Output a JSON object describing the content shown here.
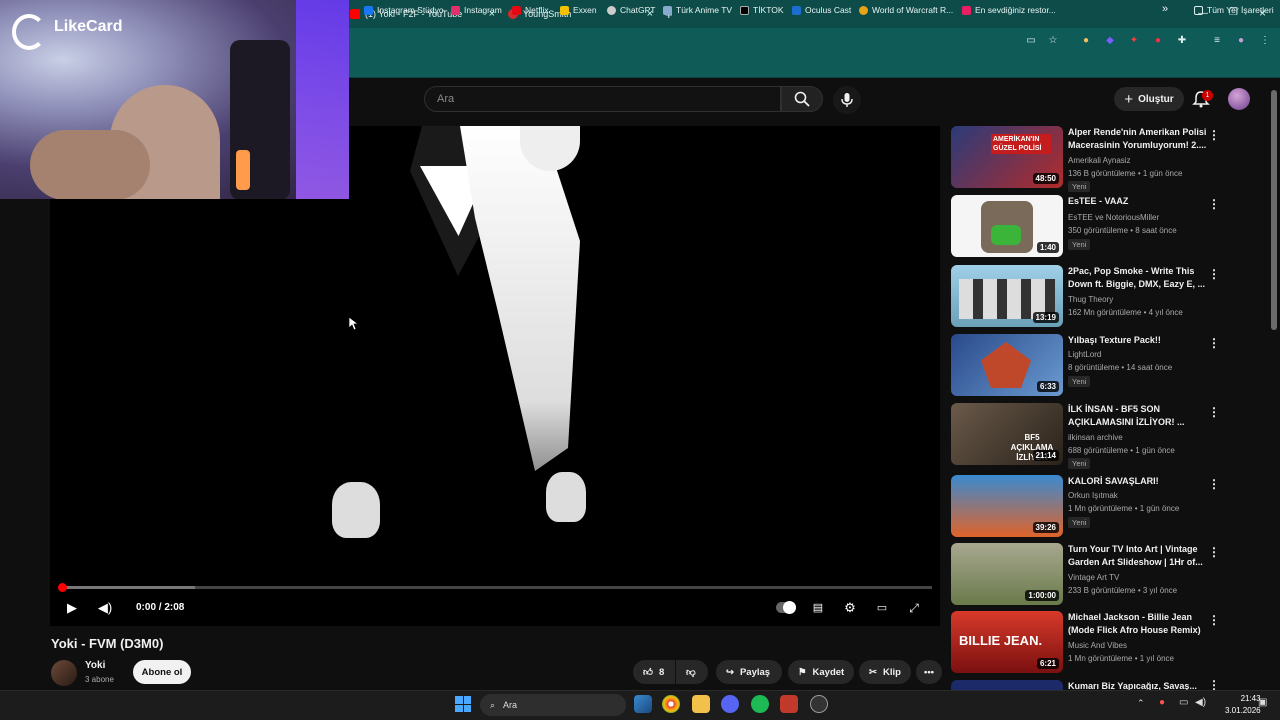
{
  "browser": {
    "tabs": [
      {
        "label": "(1) Yoki - F2F - YouTube",
        "color": "#ff0000"
      },
      {
        "label": "YoungSmith",
        "color": "#d62b2b"
      }
    ],
    "new_tab_label": "+",
    "bookmarks": [
      {
        "label": "Instagram Stüdyo",
        "color": "#1877f2"
      },
      {
        "label": "Instagram",
        "color": "#e1306c"
      },
      {
        "label": "Netflix",
        "color": "#e50914"
      },
      {
        "label": "Exxen",
        "color": "#f2c200"
      },
      {
        "label": "ChatGPT",
        "color": "#cccccc"
      },
      {
        "label": "Türk Anime TV",
        "color": "#88aacc"
      },
      {
        "label": "TİKTOK",
        "color": "#000000"
      },
      {
        "label": "Oculus Cast",
        "color": "#1c6fd1"
      },
      {
        "label": "World of Warcraft R...",
        "color": "#e8a317"
      },
      {
        "label": "En sevdiğiniz restor...",
        "color": "#e91e63"
      }
    ],
    "bookmarks_more": "»",
    "all_bookmarks": "Tüm Yer İşaretleri"
  },
  "webcam": {
    "brand": "LikeCard"
  },
  "youtube": {
    "search_placeholder": "Ara",
    "create_label": "Oluştur",
    "notification_count": "1"
  },
  "player": {
    "time": "0:00 / 2:08",
    "progress_fraction": 0,
    "buffered_fraction": 0.153
  },
  "video": {
    "title": "Yoki - FVM (D3M0)",
    "channel": "Yoki",
    "subscribers": "3 abone",
    "subscribe_label": "Abone ol",
    "likes": "8",
    "share_label": "Paylaş",
    "save_label": "Kaydet",
    "clip_label": "Klip",
    "more_label": "•••"
  },
  "recommendations": [
    {
      "title": "Alper Rende'nin Amerikan Polisi Macerasinin Yorumluyorum! 2....",
      "channel": "Amerikali Aynasiz",
      "meta": "136 B görüntüleme • 1 gün önce",
      "new": "Yeni",
      "duration": "48:50",
      "thumb": "#b22b2b"
    },
    {
      "title": "EsTEE - VAAZ",
      "channel": "EsTEE ve NotoriousMiller",
      "meta": "350 görüntüleme • 8 saat önce",
      "new": "Yeni",
      "duration": "1:40",
      "thumb": "#f5f5f5"
    },
    {
      "title": "2Pac, Pop Smoke - Write This Down ft. Biggie, DMX, Eazy E, ...",
      "channel": "Thug Theory",
      "meta": "162 Mn görüntüleme • 4 yıl önce",
      "new": "",
      "duration": "13:19",
      "thumb": "#8fbfd8"
    },
    {
      "title": "Yılbaşı Texture Pack!!",
      "channel": "LightLord",
      "meta": "8 görüntüleme • 14 saat önce",
      "new": "Yeni",
      "duration": "6:33",
      "thumb": "#3a5fa0"
    },
    {
      "title": "İLK İNSAN - BF5 SON AÇIKLAMASINI İZLİYOR! ...",
      "channel": "ilkinsan archive",
      "meta": "688 görüntüleme • 1 gün önce",
      "new": "Yeni",
      "duration": "21:14",
      "thumb": "#5a4a3c"
    },
    {
      "title": "KALORİ SAVAŞLARI!",
      "channel": "Orkun Işıtmak",
      "meta": "1 Mn görüntüleme • 1 gün önce",
      "new": "Yeni",
      "duration": "39:26",
      "thumb": "#3a8ad0"
    },
    {
      "title": "Turn Your TV Into Art | Vintage Garden Art Slideshow | 1Hr of...",
      "channel": "Vintage Art TV",
      "meta": "233 B görüntüleme • 3 yıl önce",
      "new": "",
      "duration": "1:00:00",
      "thumb": "#8a8a6a"
    },
    {
      "title": "Michael Jackson - Billie Jean (Mode Flick Afro House Remix)",
      "channel": "Music And Vibes",
      "meta": "1 Mn görüntüleme • 1 yıl önce",
      "new": "",
      "duration": "6:21",
      "thumb": "#b8242a"
    },
    {
      "title": "Kumarı Biz Yapıcağız, Savaş...",
      "channel": "",
      "meta": "",
      "new": "",
      "duration": "",
      "thumb": "#1d2a6a"
    }
  ],
  "thumb_texts": [
    "AMERİKAN'IN GÜZEL POLİSİ",
    "BF5 AÇIKLAMA İZLİYOR",
    "BILLIE JEAN."
  ],
  "taskbar": {
    "search_label": "Ara",
    "time": "21:43",
    "date": "3.01.2026"
  }
}
